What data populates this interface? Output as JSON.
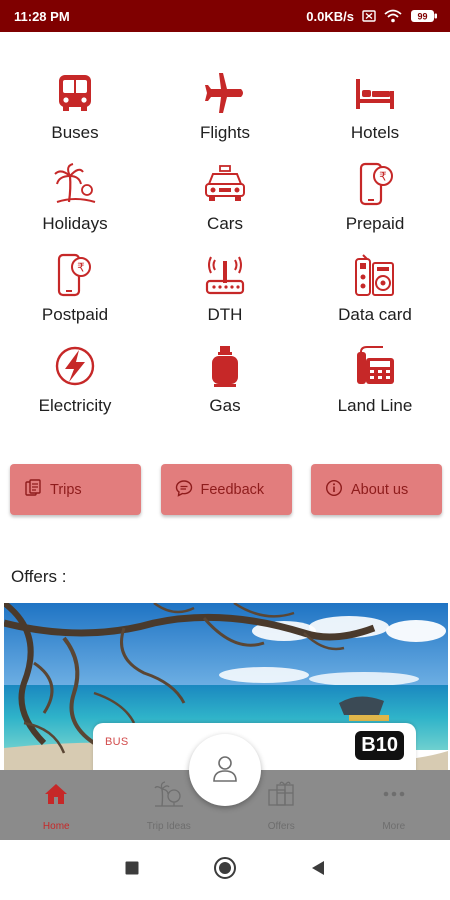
{
  "status_bar": {
    "time": "11:28 PM",
    "network_speed": "0.0KB/s",
    "battery": "99",
    "icons": [
      "sim-off-icon",
      "wifi-icon",
      "battery-icon"
    ]
  },
  "services": [
    {
      "label": "Buses",
      "icon": "bus-icon"
    },
    {
      "label": "Flights",
      "icon": "airplane-icon"
    },
    {
      "label": "Hotels",
      "icon": "bed-icon"
    },
    {
      "label": "Holidays",
      "icon": "palm-tree-icon"
    },
    {
      "label": "Cars",
      "icon": "car-icon"
    },
    {
      "label": "Prepaid",
      "icon": "mobile-rupee-icon"
    },
    {
      "label": "Postpaid",
      "icon": "mobile-rupee-icon"
    },
    {
      "label": "DTH",
      "icon": "satellite-box-icon"
    },
    {
      "label": "Data card",
      "icon": "data-card-icon"
    },
    {
      "label": "Electricity",
      "icon": "lightning-icon"
    },
    {
      "label": "Gas",
      "icon": "gas-cylinder-icon"
    },
    {
      "label": "Land Line",
      "icon": "telephone-icon"
    }
  ],
  "actions": [
    {
      "label": "Trips",
      "icon": "trips-icon"
    },
    {
      "label": "Feedback",
      "icon": "chat-bubble-icon"
    },
    {
      "label": "About us",
      "icon": "info-icon"
    }
  ],
  "offers": {
    "title": "Offers :",
    "card": {
      "tag": "BUS",
      "code": "B10"
    }
  },
  "bottom_nav": [
    {
      "label": "Home",
      "icon": "home-icon",
      "active": true
    },
    {
      "label": "Trip Ideas",
      "icon": "trip-ideas-icon",
      "active": false
    },
    {
      "label": "Offers",
      "icon": "gift-icon",
      "active": false
    },
    {
      "label": "More",
      "icon": "more-dots-icon",
      "active": false
    }
  ],
  "colors": {
    "primary": "#c62828",
    "status_bar": "#7f0000",
    "action_button": "#e27d7d",
    "bottom_nav": "#8b8b8b"
  }
}
